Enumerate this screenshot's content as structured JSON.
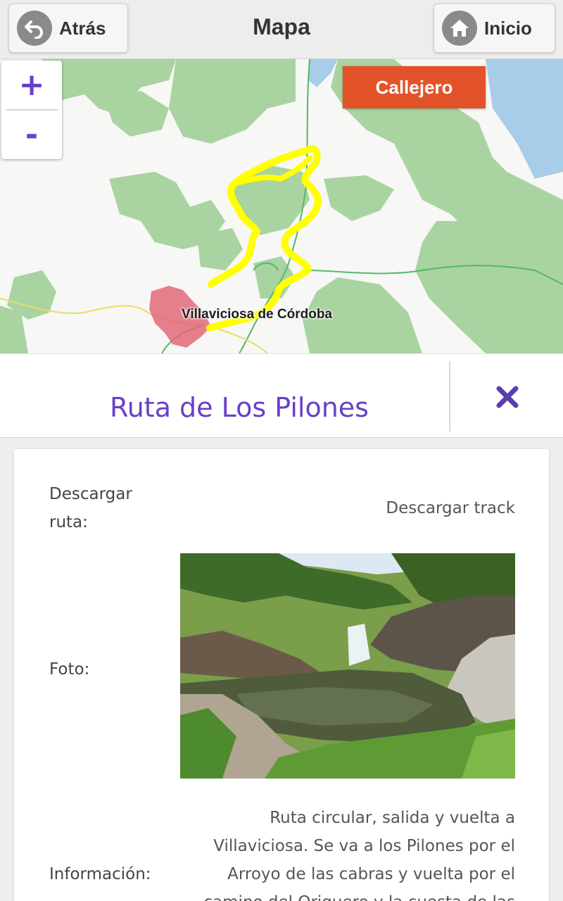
{
  "header": {
    "back_label": "Atrás",
    "title": "Mapa",
    "home_label": "Inicio"
  },
  "map": {
    "zoom_in": "+",
    "zoom_out": "-",
    "callejero_label": "Callejero",
    "town_label": "Villaviciosa de Córdoba",
    "route_color": "#ffff00",
    "forest_color": "#a9d3a1",
    "water_color": "#a8cde8"
  },
  "route": {
    "title": "Ruta de Los Pilones",
    "close_icon": "close-icon"
  },
  "details": {
    "download_label": "Descargar ruta:",
    "download_value": "Descargar track",
    "photo_label": "Foto:",
    "info_label": "Información:",
    "info_text": "Ruta circular, salida y vuelta a Villaviciosa. Se va a los Pilones por el Arroyo de las cabras y vuelta por el camino del Origuero y la cuesta de las"
  }
}
